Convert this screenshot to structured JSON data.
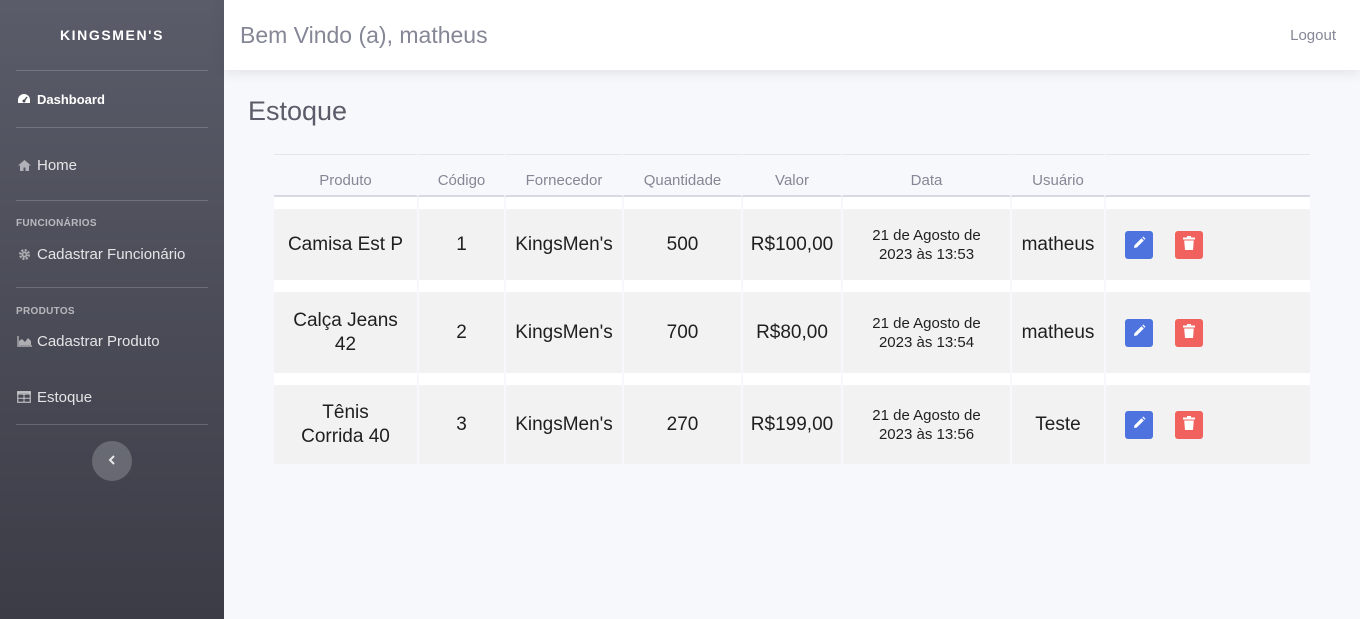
{
  "sidebar": {
    "brand": "KINGSMEN'S",
    "dashboard": "Dashboard",
    "home": "Home",
    "heading_funcionarios": "FUNCIONÁRIOS",
    "cadastrar_funcionario": "Cadastrar Funcionário",
    "heading_produtos": "PRODUTOS",
    "cadastrar_produto": "Cadastrar Produto",
    "estoque": "Estoque",
    "toggle_icon": "chevron-left-icon"
  },
  "topbar": {
    "welcome": "Bem Vindo (a), matheus",
    "logout": "Logout"
  },
  "main": {
    "title": "Estoque",
    "columns": [
      "Produto",
      "Código",
      "Fornecedor",
      "Quantidade",
      "Valor",
      "Data",
      "Usuário",
      ""
    ],
    "rows": [
      {
        "produto": "Camisa Est P",
        "codigo": "1",
        "fornecedor": "KingsMen's",
        "quantidade": "500",
        "valor": "R$100,00",
        "data": "21 de Agosto de 2023 às 13:53",
        "usuario": "matheus"
      },
      {
        "produto": "Calça Jeans 42",
        "codigo": "2",
        "fornecedor": "KingsMen's",
        "quantidade": "700",
        "valor": "R$80,00",
        "data": "21 de Agosto de 2023 às 13:54",
        "usuario": "matheus"
      },
      {
        "produto": "Tênis Corrida 40",
        "codigo": "3",
        "fornecedor": "KingsMen's",
        "quantidade": "270",
        "valor": "R$199,00",
        "data": "21 de Agosto de 2023 às 13:56",
        "usuario": "Teste"
      }
    ]
  },
  "colors": {
    "sidebar_top": "#5a5c69",
    "sidebar_bottom": "#3b3c46",
    "edit_button": "#4e73df",
    "delete_button": "#f1615e"
  }
}
